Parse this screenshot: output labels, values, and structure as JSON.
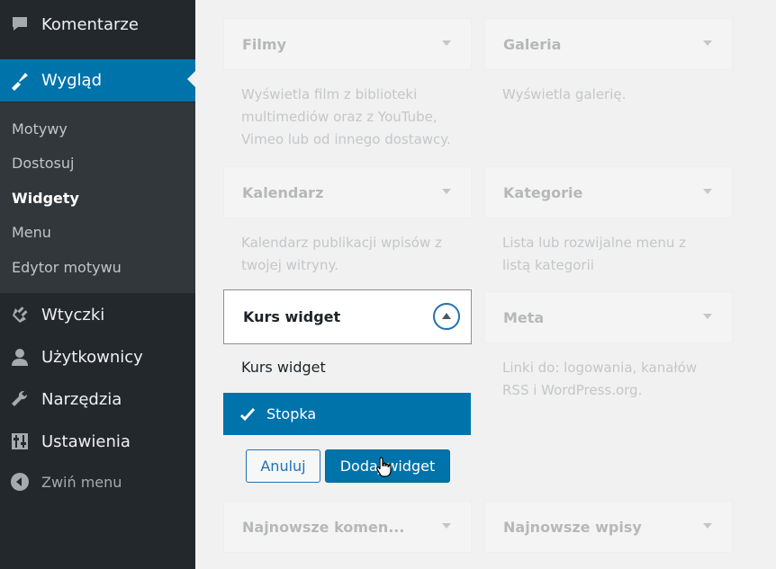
{
  "sidebar": {
    "comments_label": "Komentarze",
    "appearance_label": "Wygląd",
    "submenu": [
      "Motywy",
      "Dostosuj",
      "Widgety",
      "Menu",
      "Edytor motywu"
    ],
    "plugins_label": "Wtyczki",
    "users_label": "Użytkownicy",
    "tools_label": "Narzędzia",
    "settings_label": "Ustawienia",
    "collapse_label": "Zwiń menu"
  },
  "widgets": {
    "filmy": {
      "title": "Filmy",
      "desc": "Wyświetla film z biblioteki multimediów oraz z YouTube, Vimeo lub od innego dostawcy."
    },
    "galeria": {
      "title": "Galeria",
      "desc": "Wyświetla galerię."
    },
    "kalendarz": {
      "title": "Kalendarz",
      "desc": "Kalendarz publikacji wpisów z twojej witryny."
    },
    "kategorie": {
      "title": "Kategorie",
      "desc": "Lista lub rozwijalne menu z listą kategorii"
    },
    "meta": {
      "title": "Meta",
      "desc": "Linki do: logowania, kanałów RSS i WordPress.org."
    },
    "najnowsze_komentarze": {
      "title": "Najnowsze komen..."
    },
    "najnowsze_wpisy": {
      "title": "Najnowsze wpisy"
    }
  },
  "expanded_widget": {
    "title": "Kurs widget",
    "choose_label": "Kurs widget",
    "selected_area": "Stopka",
    "cancel_label": "Anuluj",
    "add_label": "Dodaj widget"
  },
  "colors": {
    "sidebar_bg": "#23282d",
    "accent": "#0073aa"
  }
}
